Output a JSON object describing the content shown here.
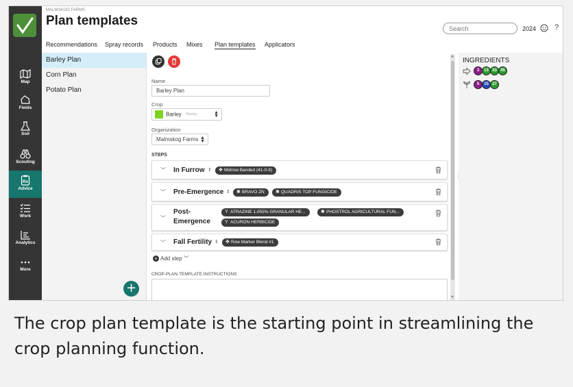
{
  "header": {
    "company": "MALMSKOG FARMS",
    "title": "Plan templates",
    "search_placeholder": "Search",
    "year": "2024",
    "help": "?"
  },
  "tabs": [
    {
      "label": "Recommendations",
      "active": false
    },
    {
      "label": "Spray records",
      "active": false
    },
    {
      "label": "Products",
      "active": false
    },
    {
      "label": "Mixes",
      "active": false
    },
    {
      "label": "Plan templates",
      "active": true
    },
    {
      "label": "Applicators",
      "active": false
    }
  ],
  "nav": [
    {
      "label": "Map",
      "icon": "map-icon"
    },
    {
      "label": "Fields",
      "icon": "fields-icon"
    },
    {
      "label": "Soil",
      "icon": "soil-icon"
    },
    {
      "label": "Scouting",
      "icon": "scouting-icon"
    },
    {
      "label": "Advice",
      "icon": "advice-icon",
      "active": true
    },
    {
      "label": "Work",
      "icon": "work-icon"
    },
    {
      "label": "Analytics",
      "icon": "analytics-icon"
    },
    {
      "label": "More",
      "icon": "more-icon"
    }
  ],
  "plans": [
    {
      "label": "Barley Plan",
      "selected": true
    },
    {
      "label": "Corn Plan",
      "selected": false
    },
    {
      "label": "Potato Plan",
      "selected": false
    }
  ],
  "detail": {
    "name_label": "Name",
    "name_value": "Barley Plan",
    "crop_label": "Crop",
    "crop_value": "Barley",
    "crop_sub": "Barley",
    "crop_color": "#7ed321",
    "org_label": "Organization",
    "org_value": "Malmskog Farms",
    "steps_label": "STEPS",
    "add_step": "Add step",
    "instructions_label": "CROP-PLAN-TEMPLATE.INSTRUCTIONS",
    "instructions_value": ""
  },
  "steps": [
    {
      "name": "In Furrow",
      "products": [
        "Midrow Banded (41-0-9)"
      ]
    },
    {
      "name": "Pre-Emergence",
      "products": [
        "BRAVO ZN",
        "QUADRIS TOP FUNGICIDE"
      ]
    },
    {
      "name": "Post-",
      "name2": "Emergence",
      "products": [
        "ATRAZINE 1.055% GRANULAR HE...",
        "PHOSTROL AGRICULTURAL FUN...",
        "ACURON HERBICIDE"
      ]
    },
    {
      "name": "Fall Fertility",
      "products": [
        "Row Marker Blend #1"
      ]
    }
  ],
  "ingredients": {
    "title": "INGREDIENTS",
    "rows": [
      {
        "icon": "nutrient-icon",
        "badges": [
          {
            "label": "3",
            "color": "#8e1f8a"
          },
          {
            "label": "13",
            "color": "#2e9a2e"
          },
          {
            "label": "33",
            "color": "#2e9a2e"
          },
          {
            "label": "45",
            "color": "#2e9a2e"
          }
        ]
      },
      {
        "icon": "plant-icon",
        "badges": [
          {
            "label": "5",
            "color": "#8e1f8a"
          },
          {
            "label": "15",
            "color": "#2647b8"
          },
          {
            "label": "27",
            "color": "#2e9a2e"
          }
        ]
      }
    ]
  },
  "caption": "The crop plan template is the starting point in streamlining the crop planning function.",
  "colors": {
    "nav_bg": "#353535",
    "nav_active": "#17766d",
    "selected_item": "#d3eef9",
    "delete_red": "#e53935",
    "chip": "#3c3c3c"
  }
}
